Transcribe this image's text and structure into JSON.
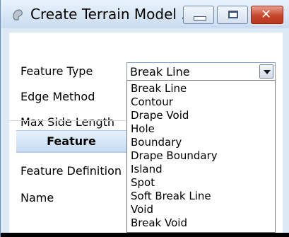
{
  "window": {
    "title": "Create Terrain Model ...",
    "accent": "#c8452b",
    "icons": [
      "app-icon",
      "minimize-icon",
      "maximize-icon",
      "close-icon"
    ]
  },
  "form": {
    "feature_type_label": "Feature Type",
    "feature_type_value": "Break Line",
    "edge_method_label": "Edge Method",
    "max_side_length_label": "Max Side Length",
    "section_header": "Feature",
    "feature_definition_label": "Feature Definition",
    "name_label": "Name"
  },
  "dropdown": {
    "options": [
      "Break Line",
      "Contour",
      "Drape Void",
      "Hole",
      "Boundary",
      "Drape Boundary",
      "Island",
      "Spot",
      "Soft Break Line",
      "Void",
      "Break Void"
    ]
  }
}
